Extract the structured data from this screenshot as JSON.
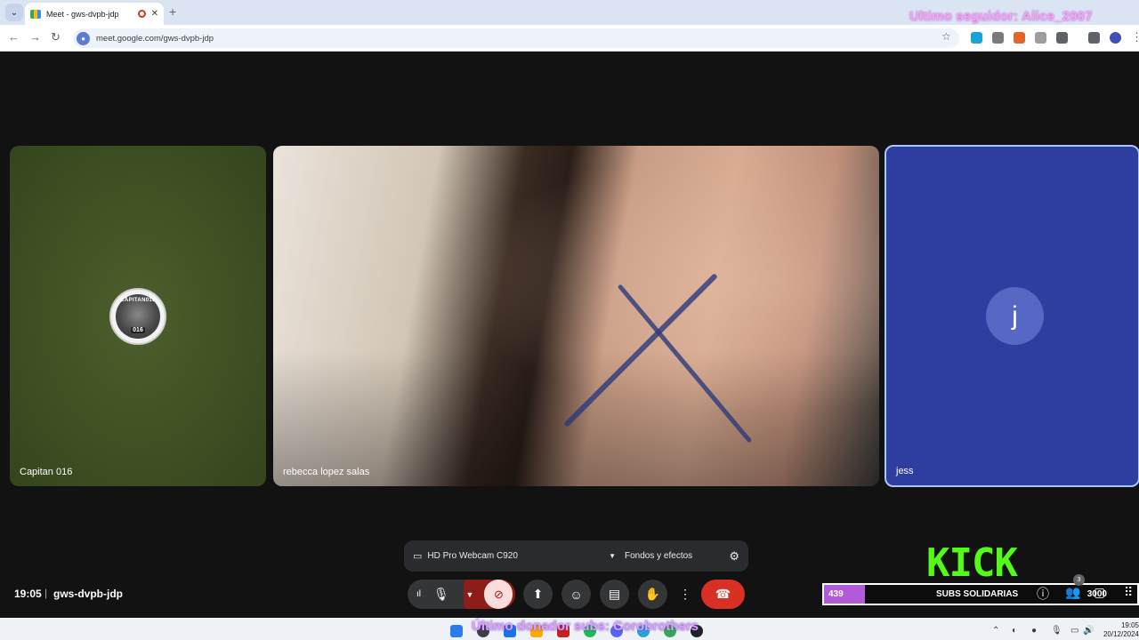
{
  "browser": {
    "tab_title": "Meet - gws-dvpb-jdp",
    "tab_close": "✕",
    "new_tab": "+",
    "url": "meet.google.com/gws-dvpb-jdp"
  },
  "stream_overlay": {
    "last_follower": "Ultimo seguidor: Alice_2007",
    "last_donor": "Último donador subs: Corobrothers"
  },
  "participants": [
    {
      "name": "Capitan 016",
      "avatar_text_top": "CAPITAN016",
      "avatar_text_bottom": "016",
      "tile_color": "#3c4d22"
    },
    {
      "name": "rebecca lopez salas"
    },
    {
      "name": "jess",
      "avatar_letter": "j",
      "tile_color": "#2e3ea0"
    }
  ],
  "device_bar": {
    "camera_label": "HD Pro Webcam C920",
    "effects_label": "Fondos y efectos"
  },
  "meeting_info": {
    "time": "19:05",
    "separator": "|",
    "code": "gws-dvpb-jdp"
  },
  "controls": {
    "end_call_color": "#d93025",
    "camera_off_color": "#8c1d18"
  },
  "kick": {
    "logo": "KICK",
    "progress_value": "439",
    "label": "SUBS SOLIDARIAS",
    "goal": "3000",
    "people_badge": "3",
    "accent": "#53fc18"
  },
  "taskbar": {
    "time": "19:05",
    "date": "20/12/2024"
  }
}
